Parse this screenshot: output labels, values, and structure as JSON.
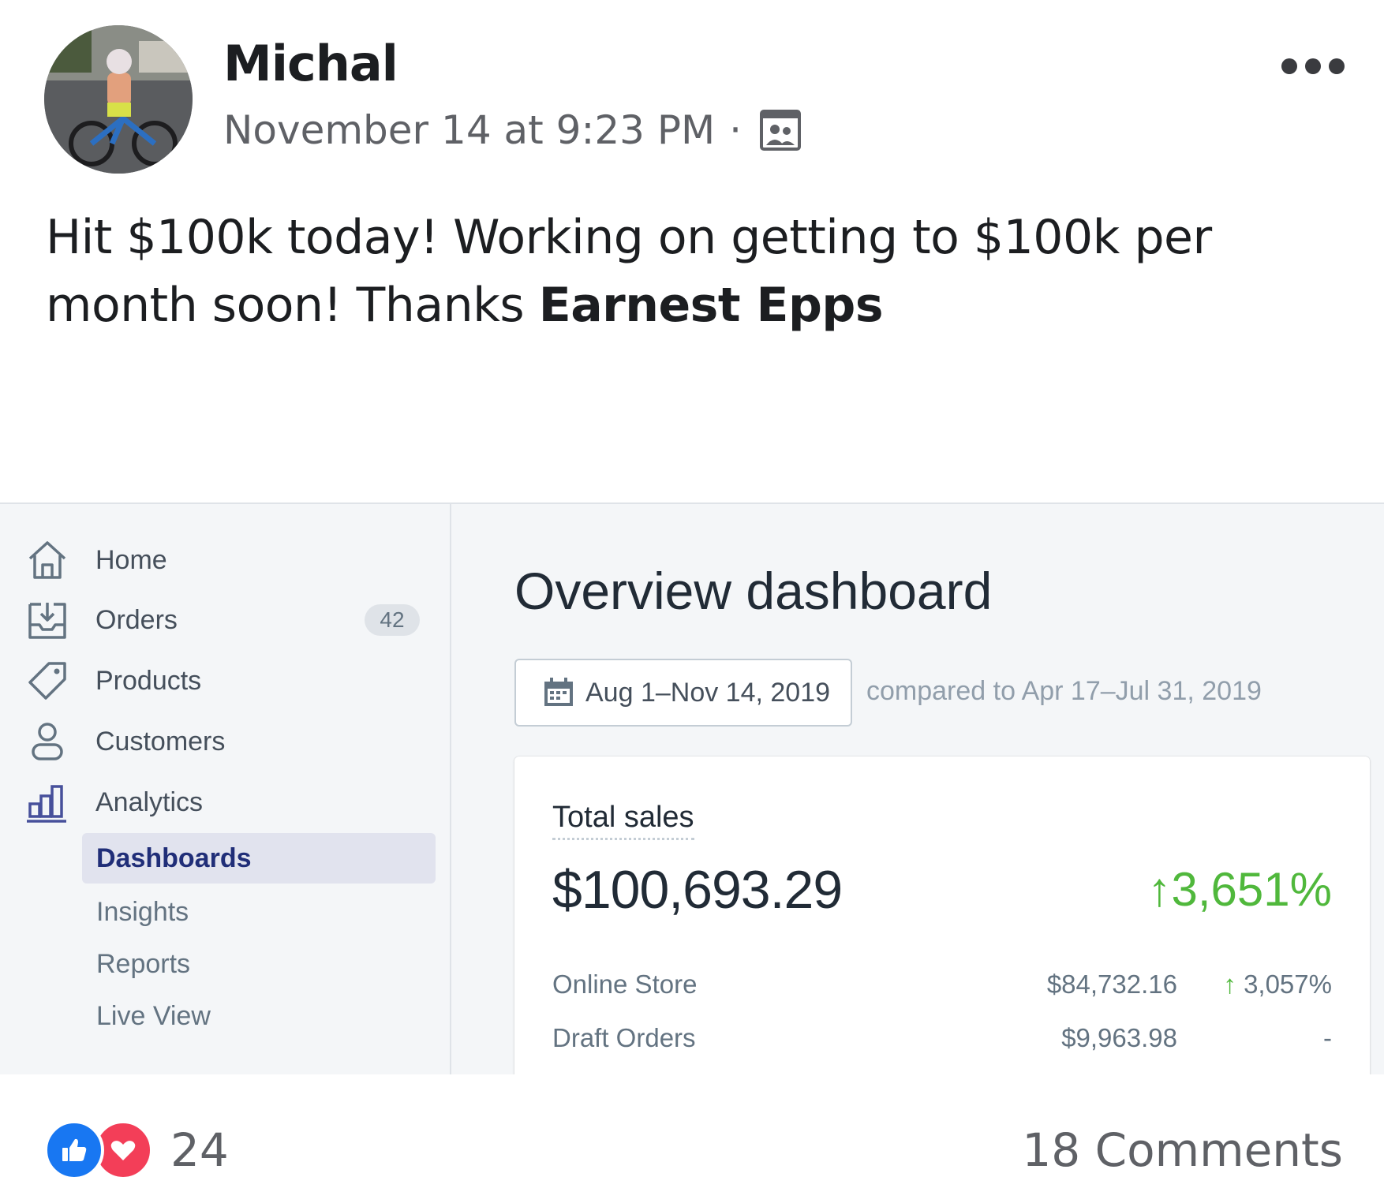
{
  "post": {
    "author": "Michal",
    "timestamp": "November 14 at 9:23 PM",
    "separator": "·",
    "audience_icon": "group-audience-icon",
    "text_before": "Hit $100k today! Working on getting to $100k per month soon! Thanks ",
    "tagged_name": "Earnest Epps"
  },
  "dashboard": {
    "sidebar": {
      "items": [
        {
          "label": "Home",
          "icon": "home-icon"
        },
        {
          "label": "Orders",
          "icon": "orders-icon",
          "badge": "42"
        },
        {
          "label": "Products",
          "icon": "tag-icon"
        },
        {
          "label": "Customers",
          "icon": "person-icon"
        },
        {
          "label": "Analytics",
          "icon": "bar-chart-icon"
        }
      ],
      "sub_items": [
        {
          "label": "Dashboards",
          "active": true
        },
        {
          "label": "Insights"
        },
        {
          "label": "Reports"
        },
        {
          "label": "Live View"
        }
      ]
    },
    "title": "Overview dashboard",
    "date_range": "Aug 1–Nov 14, 2019",
    "compare_text": "compared to Apr 17–Jul 31, 2019",
    "card": {
      "title": "Total sales",
      "total": "$100,693.29",
      "growth": "3,651%",
      "rows": [
        {
          "name": "Online Store",
          "amount": "$84,732.16",
          "change": "3,057%"
        },
        {
          "name": "Draft Orders",
          "amount": "$9,963.98",
          "change": "-"
        }
      ]
    },
    "colors": {
      "accent": "#202e78",
      "positive": "#50b83c",
      "sidebar_bg": "#f4f6f8"
    }
  },
  "footer": {
    "reaction_count": "24",
    "comments": "18 Comments",
    "reaction_icons": [
      "like-icon",
      "love-icon"
    ]
  }
}
